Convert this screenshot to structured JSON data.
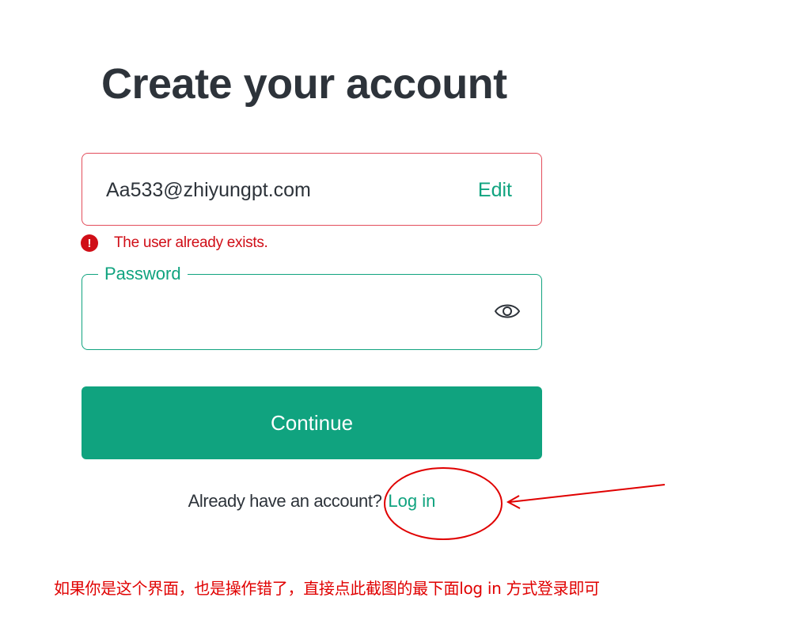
{
  "page": {
    "title": "Create your account"
  },
  "email_field": {
    "value": "Aa533@zhiyungpt.com",
    "edit_label": "Edit"
  },
  "error": {
    "icon_glyph": "!",
    "message": "The user already exists."
  },
  "password_field": {
    "label": "Password",
    "value": "",
    "icon": "eye-icon"
  },
  "continue_button": {
    "label": "Continue"
  },
  "login_prompt": {
    "text": "Already have an account?",
    "link_label": "Log in"
  },
  "annotation": {
    "note": "如果你是这个界面，也是操作错了，直接点此截图的最下面log in 方式登录即可",
    "color": "#e00000"
  },
  "colors": {
    "accent": "#10a37f",
    "error": "#d00e17",
    "error_border": "#e34d5b",
    "text": "#2d333a"
  }
}
